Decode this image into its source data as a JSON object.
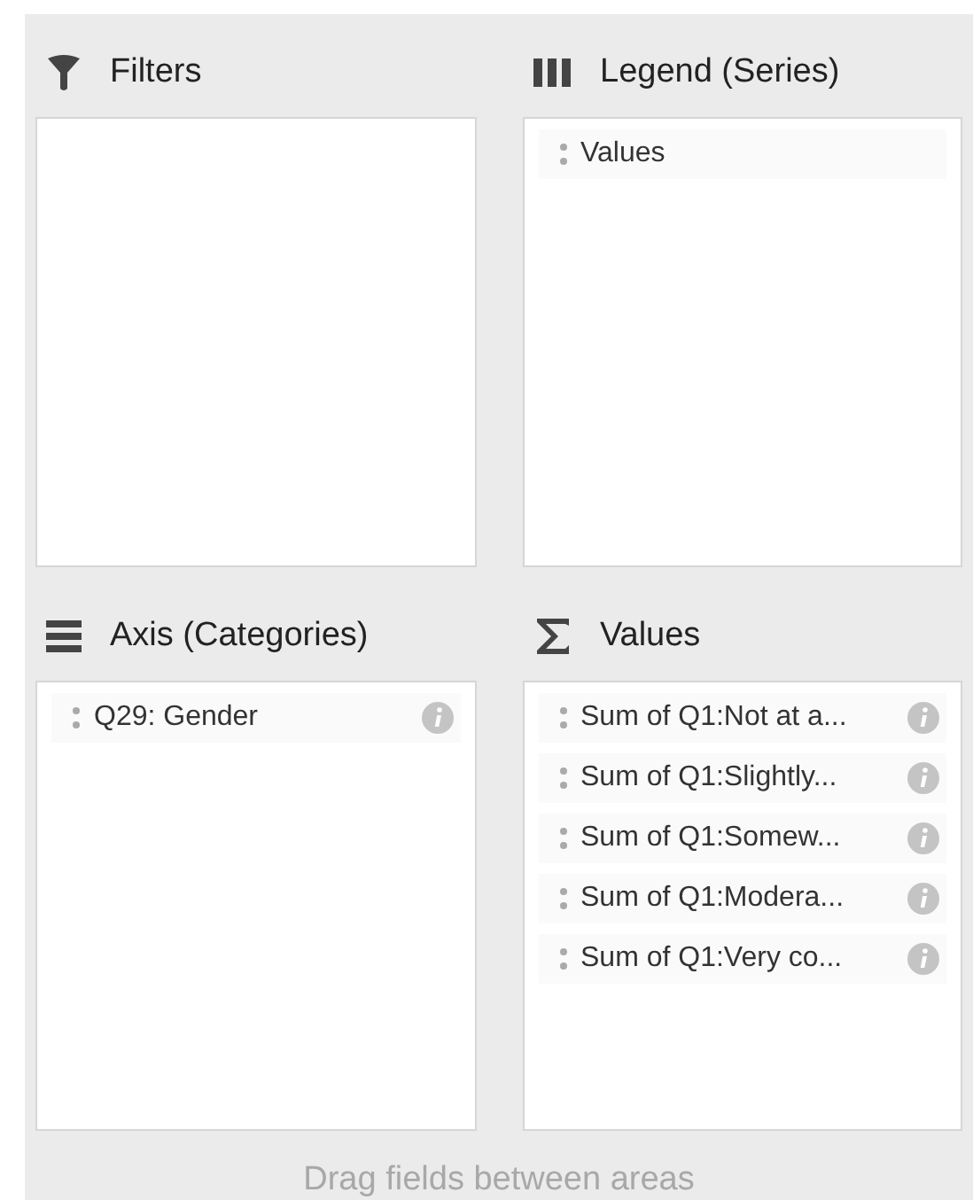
{
  "areas": [
    {
      "kind": "filter",
      "title": "Filters"
    },
    {
      "kind": "legend",
      "title": "Legend (Series)",
      "fields": [
        {
          "label": "Values",
          "info": false
        }
      ]
    },
    {
      "kind": "axis",
      "title": "Axis (Categories)",
      "fields": [
        {
          "label": "Q29: Gender",
          "info": true
        }
      ]
    },
    {
      "kind": "values",
      "title": "Values",
      "fields": [
        {
          "label": "Sum of Q1:Not at a...",
          "info": true
        },
        {
          "label": "Sum of Q1:Slightly...",
          "info": true
        },
        {
          "label": "Sum of Q1:Somew...",
          "info": true
        },
        {
          "label": "Sum of Q1:Modera...",
          "info": true
        },
        {
          "label": "Sum of Q1:Very co...",
          "info": true
        }
      ]
    }
  ],
  "hint": "Drag fields between areas"
}
